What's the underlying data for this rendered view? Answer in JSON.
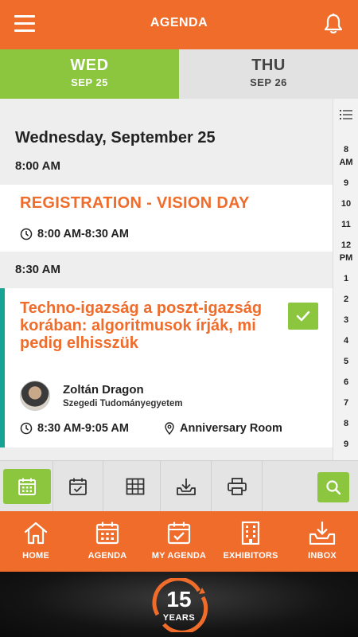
{
  "header": {
    "title": "AGENDA"
  },
  "days": [
    {
      "name": "WED",
      "date": "SEP 25"
    },
    {
      "name": "THU",
      "date": "SEP 26"
    }
  ],
  "agenda": {
    "day_heading": "Wednesday, September 25",
    "groups": [
      {
        "time": "8:00 AM",
        "session": {
          "title": "REGISTRATION - VISION DAY",
          "time": "8:00 AM-8:30 AM"
        }
      },
      {
        "time": "8:30 AM",
        "session": {
          "title": "Techno-igazság a poszt-igazság korában: algoritmusok írják, mi pedig elhisszük",
          "speaker_name": "Zoltán Dragon",
          "speaker_org": "Szegedi Tudományegyetem",
          "time": "8:30 AM-9:05 AM",
          "location": "Anniversary Room",
          "added": true
        }
      }
    ]
  },
  "time_index": [
    "8",
    "AM",
    "9",
    "10",
    "11",
    "12",
    "PM",
    "1",
    "2",
    "3",
    "4",
    "5",
    "6",
    "7",
    "8",
    "9"
  ],
  "toolbar": {
    "items": [
      "calendar-grid-view",
      "my-agenda-view",
      "table-view",
      "download",
      "print"
    ],
    "active": "calendar-grid-view"
  },
  "bottom_nav": [
    {
      "label": "HOME",
      "icon": "home-icon"
    },
    {
      "label": "AGENDA",
      "icon": "calendar-icon"
    },
    {
      "label": "MY AGENDA",
      "icon": "calendar-check-icon"
    },
    {
      "label": "EXHIBITORS",
      "icon": "building-icon"
    },
    {
      "label": "INBOX",
      "icon": "inbox-download-icon"
    }
  ],
  "footer": {
    "badge_number": "15",
    "badge_text": "YEARS"
  },
  "colors": {
    "primary": "#ef6c2b",
    "accent": "#8cc63f",
    "teal": "#16a394"
  }
}
